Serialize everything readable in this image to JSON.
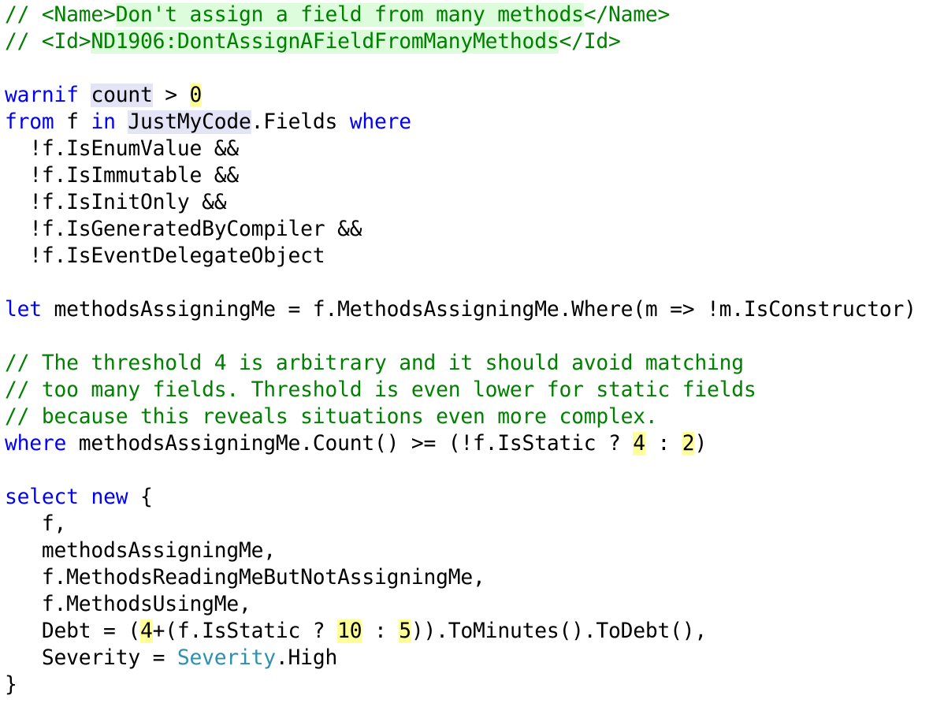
{
  "editor": {
    "lines": [
      [
        {
          "t": "// <Name>",
          "c": "cm"
        },
        {
          "t": "Don't assign a field from many methods",
          "c": "cm hl-green"
        },
        {
          "t": "</Name>",
          "c": "cm"
        }
      ],
      [
        {
          "t": "// <Id>",
          "c": "cm"
        },
        {
          "t": "ND1906:DontAssignAFieldFromManyMethods",
          "c": "cm hl-green"
        },
        {
          "t": "</Id>",
          "c": "cm"
        }
      ],
      [],
      [
        {
          "t": "warnif",
          "c": "kw"
        },
        {
          "t": " "
        },
        {
          "t": "count",
          "c": "hl-blue"
        },
        {
          "t": " > "
        },
        {
          "t": "0",
          "c": "hl-yellow"
        }
      ],
      [
        {
          "t": "from",
          "c": "kw"
        },
        {
          "t": " f "
        },
        {
          "t": "in",
          "c": "kw"
        },
        {
          "t": " "
        },
        {
          "t": "JustMyCode",
          "c": "hl-blue"
        },
        {
          "t": ".Fields "
        },
        {
          "t": "where",
          "c": "kw"
        }
      ],
      [
        {
          "t": "  !f.IsEnumValue &&"
        }
      ],
      [
        {
          "t": "  !f.IsImmutable &&"
        }
      ],
      [
        {
          "t": "  !f.IsInitOnly &&"
        }
      ],
      [
        {
          "t": "  !f.IsGeneratedByCompiler &&"
        }
      ],
      [
        {
          "t": "  !f.IsEventDelegateObject"
        }
      ],
      [],
      [
        {
          "t": "let",
          "c": "kw"
        },
        {
          "t": " methodsAssigningMe = f.MethodsAssigningMe.Where(m => !m.IsConstructor)"
        }
      ],
      [],
      [
        {
          "t": "// The threshold 4 is arbitrary and it should avoid matching",
          "c": "cm"
        }
      ],
      [
        {
          "t": "// too many fields. Threshold is even lower for static fields",
          "c": "cm"
        }
      ],
      [
        {
          "t": "// because this reveals situations even more complex.",
          "c": "cm"
        }
      ],
      [
        {
          "t": "where",
          "c": "kw"
        },
        {
          "t": " methodsAssigningMe.Count() >= (!f.IsStatic ? "
        },
        {
          "t": "4",
          "c": "hl-yellow"
        },
        {
          "t": " : "
        },
        {
          "t": "2",
          "c": "hl-yellow"
        },
        {
          "t": ")"
        }
      ],
      [],
      [
        {
          "t": "select",
          "c": "kw"
        },
        {
          "t": " "
        },
        {
          "t": "new",
          "c": "kw"
        },
        {
          "t": " {"
        }
      ],
      [
        {
          "t": "   f,"
        }
      ],
      [
        {
          "t": "   methodsAssigningMe,"
        }
      ],
      [
        {
          "t": "   f.MethodsReadingMeButNotAssigningMe,"
        }
      ],
      [
        {
          "t": "   f.MethodsUsingMe,"
        }
      ],
      [
        {
          "t": "   Debt = ("
        },
        {
          "t": "4",
          "c": "hl-yellow"
        },
        {
          "t": "+(f.IsStatic ? "
        },
        {
          "t": "10",
          "c": "hl-yellow"
        },
        {
          "t": " : "
        },
        {
          "t": "5",
          "c": "hl-yellow"
        },
        {
          "t": ")).ToMinutes().ToDebt(),"
        }
      ],
      [
        {
          "t": "   Severity = "
        },
        {
          "t": "Severity",
          "c": "ty"
        },
        {
          "t": ".High"
        }
      ],
      [
        {
          "t": "}"
        }
      ]
    ]
  },
  "colors": {
    "keyword": "#0000ff",
    "comment": "#008000",
    "type": "#2b91af",
    "highlight_green": "#dcfcdc",
    "highlight_blue": "#e4e4f7",
    "highlight_yellow": "#ffff99"
  }
}
